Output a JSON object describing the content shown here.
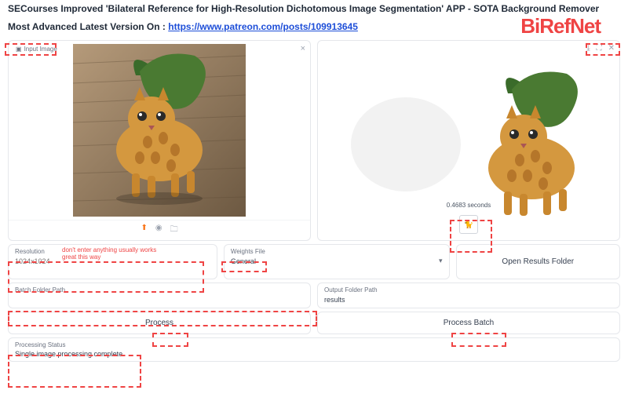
{
  "header": {
    "title": "SECourses Improved 'Bilateral Reference for High-Resolution Dichotomous Image Segmentation' APP - SOTA Background Remover",
    "subtitle_prefix": "Most Advanced Latest Version On : ",
    "link_text": "https://www.patreon.com/posts/109913645",
    "brand": "BiRefNet"
  },
  "input_panel": {
    "label": "Input Image",
    "close_glyph": "×"
  },
  "output_panel": {
    "timing": "0.4683 seconds",
    "download_icon": "⤓",
    "fullscreen_icon": "⛶",
    "close_icon": "✕",
    "thumb_glyph": "🐈"
  },
  "toolbar_icons": {
    "upload": "⬆",
    "camera": "◉",
    "clipboard": "🗀"
  },
  "fields": {
    "resolution": {
      "label": "Resolution",
      "placeholder": "1024x1024",
      "note": "don't enter anything usually works great this way"
    },
    "weights": {
      "label": "Weights File",
      "value": "General"
    },
    "open_results": {
      "label": "Open Results Folder"
    },
    "batch_path": {
      "label": "Batch Folder Path",
      "value": ""
    },
    "output_path": {
      "label": "Output Folder Path",
      "value": "results"
    },
    "process": {
      "label": "Process"
    },
    "process_batch": {
      "label": "Process Batch"
    },
    "status": {
      "label": "Processing Status",
      "value": "Single image processing complete."
    }
  }
}
